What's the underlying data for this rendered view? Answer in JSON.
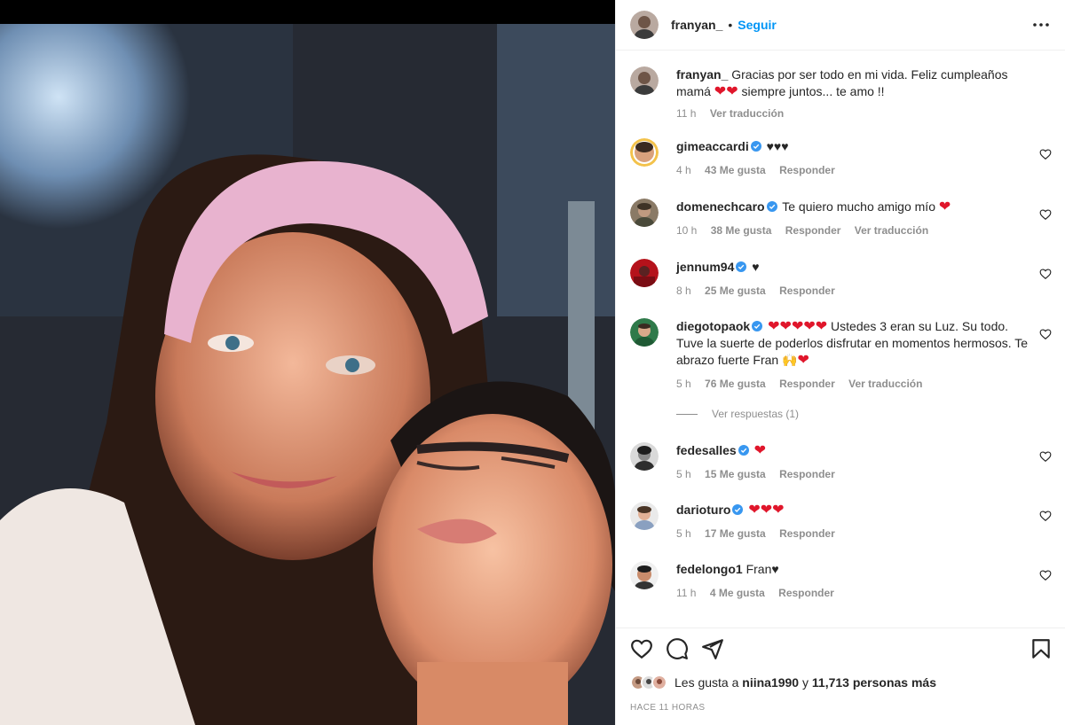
{
  "header": {
    "username": "franyan_",
    "separator": "•",
    "follow_label": "Seguir"
  },
  "caption": {
    "username": "franyan_",
    "text_1": "Gracias por ser todo en mi vida. Feliz cumpleaños mamá",
    "text_2": "siempre juntos... te amo !!",
    "time": "11 h",
    "translate": "Ver traducción"
  },
  "comments": [
    {
      "username": "gimeaccardi",
      "text": "♥♥♥",
      "time": "4 h",
      "likes": "43 Me gusta",
      "reply": "Responder"
    },
    {
      "username": "domenechcaro",
      "text": "Te quiero mucho amigo mío",
      "time": "10 h",
      "likes": "38 Me gusta",
      "reply": "Responder",
      "translate": "Ver traducción"
    },
    {
      "username": "jennum94",
      "text": "♥",
      "time": "8 h",
      "likes": "25 Me gusta",
      "reply": "Responder"
    },
    {
      "username": "diegotopaok",
      "text": "Ustedes 3 eran su Luz. Su todo. Tuve la suerte de poderlos disfrutar en momentos hermosos. Te abrazo fuerte Fran",
      "time": "5 h",
      "likes": "76 Me gusta",
      "reply": "Responder",
      "translate": "Ver traducción"
    },
    {
      "username": "fedesalles",
      "text": "",
      "time": "5 h",
      "likes": "15 Me gusta",
      "reply": "Responder"
    },
    {
      "username": "darioturo",
      "text": "",
      "time": "5 h",
      "likes": "17 Me gusta",
      "reply": "Responder"
    },
    {
      "username": "fedelongo1",
      "text": "Fran♥",
      "time": "11 h",
      "likes": "4 Me gusta",
      "reply": "Responder"
    }
  ],
  "view_replies": "Ver respuestas (1)",
  "likes_summary": {
    "prefix": "Les gusta a",
    "user": "niina1990",
    "joiner": "y",
    "count": "11,713 personas más"
  },
  "time_ago": "HACE 11 HORAS",
  "colors": {
    "accent": "#0095f6",
    "verified": "#3897f0",
    "heart": "#e0162b",
    "muted": "#8e8e8e"
  },
  "icons": [
    "more-icon",
    "heart-icon",
    "comment-icon",
    "share-icon",
    "bookmark-icon",
    "verified-icon",
    "small-heart-icon"
  ]
}
